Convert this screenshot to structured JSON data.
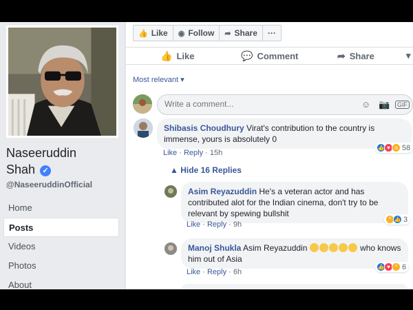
{
  "page": {
    "name_line1": "Naseeruddin",
    "name_line2": "Shah",
    "handle": "@NaseeruddinOfficial"
  },
  "nav": [
    {
      "label": "Home",
      "active": false
    },
    {
      "label": "Posts",
      "active": true
    },
    {
      "label": "Videos",
      "active": false
    },
    {
      "label": "Photos",
      "active": false
    },
    {
      "label": "About",
      "active": false
    }
  ],
  "action_bar": {
    "like": "Like",
    "follow": "Follow",
    "share": "Share",
    "more": "···"
  },
  "post_actions": {
    "like": "Like",
    "comment": "Comment",
    "share": "Share"
  },
  "sort": {
    "label": "Most relevant ▾"
  },
  "composer": {
    "placeholder": "Write a comment..."
  },
  "comments": {
    "c1": {
      "author": "Shibasis Choudhury",
      "text": "Virat's contribution to the country is immense, yours is absolutely 0",
      "like": "Like",
      "reply": "Reply",
      "time": "15h",
      "reactions": "58"
    },
    "hide_replies": "Hide 16 Replies",
    "r1": {
      "author": "Asim Reyazuddin",
      "text": "He's a veteran actor and has contributed alot for the Indian cinema, don't try to be relevant by spewing bullshit",
      "like": "Like",
      "reply": "Reply",
      "time": "9h",
      "reactions": "3"
    },
    "r2": {
      "author": "Manoj Shukla",
      "mention": "Asim Reyazuddin",
      "text_after": "who knows him out of Asia",
      "like": "Like",
      "reply": "Reply",
      "time": "6h",
      "reactions": "6"
    }
  },
  "colors": {
    "link": "#385898",
    "like_blue": "#1877f2",
    "background": "#e9ebee"
  }
}
